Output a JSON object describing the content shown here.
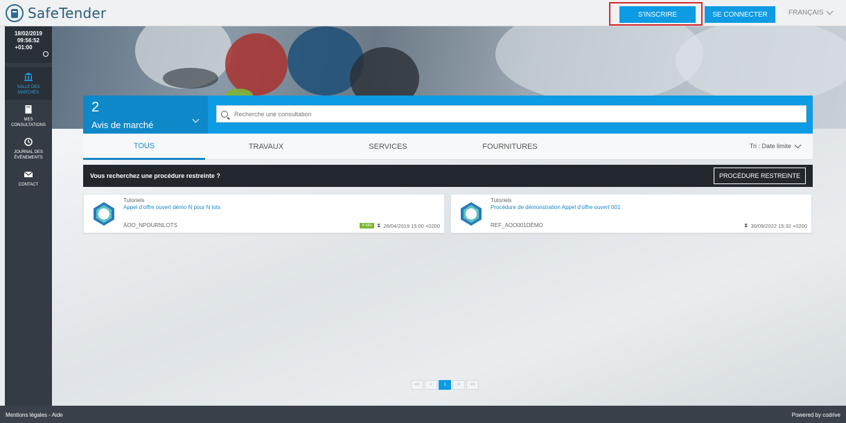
{
  "app": {
    "name": "SafeTender"
  },
  "header": {
    "register_label": "S'INSCRIRE",
    "login_label": "SE CONNECTER",
    "language": "FRANÇAIS"
  },
  "sidebar": {
    "date": "18/02/2019",
    "time": "09:56:52",
    "timezone": "+01:00",
    "items": [
      {
        "label": "SALLE DES MARCHÉS",
        "icon": "bank-icon",
        "active": true
      },
      {
        "label": "MES CONSULTATIONS",
        "icon": "document-icon",
        "active": false
      },
      {
        "label": "JOURNAL DES ÉVÈNEMENTS",
        "icon": "history-icon",
        "active": false
      },
      {
        "label": "CONTACT",
        "icon": "envelope-icon",
        "active": false
      }
    ]
  },
  "main": {
    "count": "2",
    "count_label": "Avis de marché",
    "search_placeholder": "Recherche une consultation",
    "tabs": [
      "TOUS",
      "TRAVAUX",
      "SERVICES",
      "FOURNITURES"
    ],
    "sort_label": "Tri : Date limite",
    "restricted_text": "Vous recherchez une procédure restreinte ?",
    "restricted_button": "PROCÉDURE RESTREINTE",
    "offers": [
      {
        "category": "Tutoriels",
        "title": "Appel d'offre ouvert démo N pour N lots",
        "reference": "AOO_NPOURNLOTS",
        "lots": "4 lots",
        "deadline": "26/04/2019 15:00 +0200"
      },
      {
        "category": "Tutoriels",
        "title": "Procédure de démonstration Appel d'offre ouvert 001",
        "reference": "REF_AOO001DÉMO",
        "deadline": "30/09/2022 15:32 +0200"
      }
    ],
    "pagination": {
      "first": "<<",
      "prev": "<",
      "current": "1",
      "next": ">",
      "last": ">>"
    }
  },
  "footer": {
    "legal": "Mentions légales - Aide",
    "powered": "Powered by codrive"
  },
  "colors": {
    "accent": "#0d9be4",
    "sidebar": "#343b44",
    "highlight": "#d42a2a",
    "lots_badge": "#7ab530"
  }
}
